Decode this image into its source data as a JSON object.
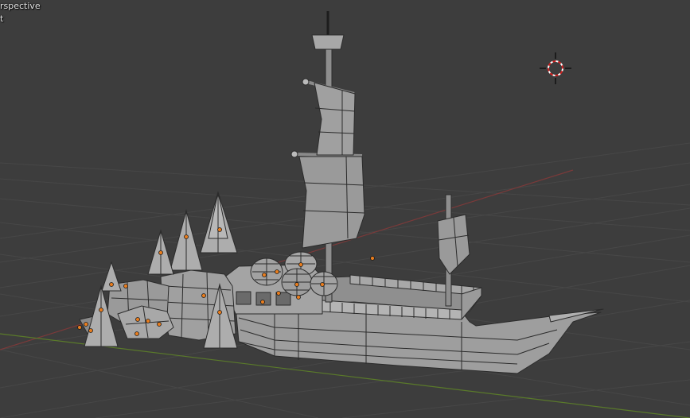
{
  "viewport": {
    "view_label": "rspective",
    "object_label": "t"
  },
  "colors": {
    "background": "#3d3d3d",
    "grid": "#474747",
    "x_axis": "#7a3a3a",
    "y_axis": "#5a7a2a",
    "mesh_face": "#9c9c9c",
    "mesh_edge": "#2b2b2b",
    "origin_dot": "#e87d1e"
  },
  "icons": {
    "cursor": "3d-cursor-icon"
  }
}
